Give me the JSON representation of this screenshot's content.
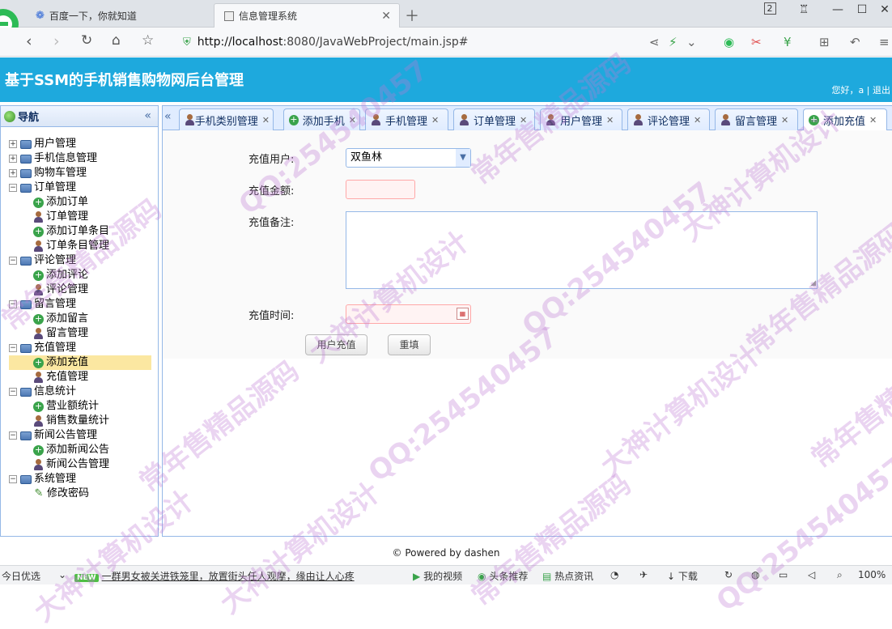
{
  "browser": {
    "tabs": [
      {
        "title": "百度一下，你就知道"
      },
      {
        "title": "信息管理系统"
      }
    ],
    "url_host": "http://localhost",
    "url_rest": ":8080/JavaWebProject/main.jsp#",
    "tab_count": "2"
  },
  "app": {
    "title": "基于SSM的手机销售购物网后台管理",
    "greeting": "您好，a",
    "separator": "|",
    "logout": "退出"
  },
  "nav": {
    "title": "导航",
    "tree": [
      {
        "label": "用户管理",
        "expanded": false,
        "children": []
      },
      {
        "label": "手机信息管理",
        "expanded": false,
        "children": []
      },
      {
        "label": "购物车管理",
        "expanded": false,
        "children": []
      },
      {
        "label": "订单管理",
        "expanded": true,
        "children": [
          {
            "label": "添加订单",
            "icon": "add-icon"
          },
          {
            "label": "订单管理",
            "icon": "user-icon"
          },
          {
            "label": "添加订单条目",
            "icon": "add-icon"
          },
          {
            "label": "订单条目管理",
            "icon": "user-icon"
          }
        ]
      },
      {
        "label": "评论管理",
        "expanded": true,
        "children": [
          {
            "label": "添加评论",
            "icon": "add-icon"
          },
          {
            "label": "评论管理",
            "icon": "user-icon"
          }
        ]
      },
      {
        "label": "留言管理",
        "expanded": true,
        "children": [
          {
            "label": "添加留言",
            "icon": "add-icon"
          },
          {
            "label": "留言管理",
            "icon": "user-icon"
          }
        ]
      },
      {
        "label": "充值管理",
        "expanded": true,
        "children": [
          {
            "label": "添加充值",
            "icon": "add-icon",
            "selected": true
          },
          {
            "label": "充值管理",
            "icon": "user-icon"
          }
        ]
      },
      {
        "label": "信息统计",
        "expanded": true,
        "children": [
          {
            "label": "营业额统计",
            "icon": "add-icon"
          },
          {
            "label": "销售数量统计",
            "icon": "user-icon"
          }
        ]
      },
      {
        "label": "新闻公告管理",
        "expanded": true,
        "children": [
          {
            "label": "添加新闻公告",
            "icon": "add-icon"
          },
          {
            "label": "新闻公告管理",
            "icon": "user-icon"
          }
        ]
      },
      {
        "label": "系统管理",
        "expanded": true,
        "children": [
          {
            "label": "修改密码",
            "icon": "pencil-icon"
          }
        ]
      }
    ]
  },
  "content_tabs": [
    {
      "label": "手机类别管理",
      "icon": "user-icon"
    },
    {
      "label": "添加手机",
      "icon": "add-icon"
    },
    {
      "label": "手机管理",
      "icon": "user-icon"
    },
    {
      "label": "订单管理",
      "icon": "user-icon"
    },
    {
      "label": "用户管理",
      "icon": "user-icon"
    },
    {
      "label": "评论管理",
      "icon": "user-icon"
    },
    {
      "label": "留言管理",
      "icon": "user-icon"
    },
    {
      "label": "添加充值",
      "icon": "add-icon",
      "active": true
    }
  ],
  "form": {
    "user_label": "充值用户:",
    "user_value": "双鱼林",
    "amount_label": "充值金额:",
    "amount_value": "",
    "remark_label": "充值备注:",
    "remark_value": "",
    "time_label": "充值时间:",
    "time_value": "",
    "submit_label": "用户充值",
    "reset_label": "重填"
  },
  "footer": {
    "text": "© Powered by dashen"
  },
  "statusbar": {
    "left": "今日优选",
    "news_badge": "NEW",
    "news": "一群男女被关进铁笼里，放置街头任人观摩，缘由让人心疼",
    "video": "我的视频",
    "headline": "头条推荐",
    "hot": "热点资讯",
    "download": "下载",
    "zoom": "100%"
  },
  "watermarks": [
    "QQ:254540457",
    "常年售精品源码",
    "大神计算机设计"
  ]
}
